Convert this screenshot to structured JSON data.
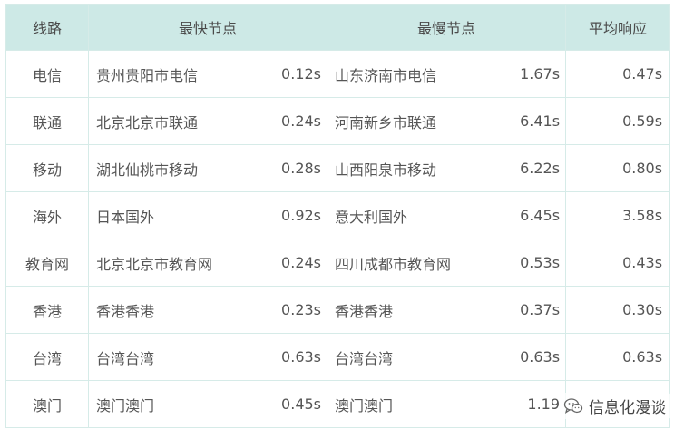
{
  "headers": {
    "line": "线路",
    "fastest_node": "最快节点",
    "slowest_node": "最慢节点",
    "avg_response": "平均响应"
  },
  "rows": [
    {
      "line": "电信",
      "fast_node": "贵州贵阳市电信",
      "fast_time": "0.12s",
      "slow_node": "山东济南市电信",
      "slow_time": "1.67s",
      "avg": "0.47s"
    },
    {
      "line": "联通",
      "fast_node": "北京北京市联通",
      "fast_time": "0.24s",
      "slow_node": "河南新乡市联通",
      "slow_time": "6.41s",
      "avg": "0.59s"
    },
    {
      "line": "移动",
      "fast_node": "湖北仙桃市移动",
      "fast_time": "0.28s",
      "slow_node": "山西阳泉市移动",
      "slow_time": "6.22s",
      "avg": "0.80s"
    },
    {
      "line": "海外",
      "fast_node": "日本国外",
      "fast_time": "0.92s",
      "slow_node": "意大利国外",
      "slow_time": "6.45s",
      "avg": "3.58s"
    },
    {
      "line": "教育网",
      "fast_node": "北京北京市教育网",
      "fast_time": "0.24s",
      "slow_node": "四川成都市教育网",
      "slow_time": "0.53s",
      "avg": "0.43s"
    },
    {
      "line": "香港",
      "fast_node": "香港香港",
      "fast_time": "0.23s",
      "slow_node": "香港香港",
      "slow_time": "0.37s",
      "avg": "0.30s"
    },
    {
      "line": "台湾",
      "fast_node": "台湾台湾",
      "fast_time": "0.63s",
      "slow_node": "台湾台湾",
      "slow_time": "0.63s",
      "avg": "0.63s"
    },
    {
      "line": "澳门",
      "fast_node": "澳门澳门",
      "fast_time": "0.45s",
      "slow_node": "澳门澳门",
      "slow_time": "1.19",
      "avg": ""
    }
  ],
  "watermark": {
    "text": "信息化漫谈",
    "icon": "wechat-icon"
  },
  "colors": {
    "header_bg": "#cde9e6",
    "border": "#d6ebe8",
    "text": "#555555"
  }
}
